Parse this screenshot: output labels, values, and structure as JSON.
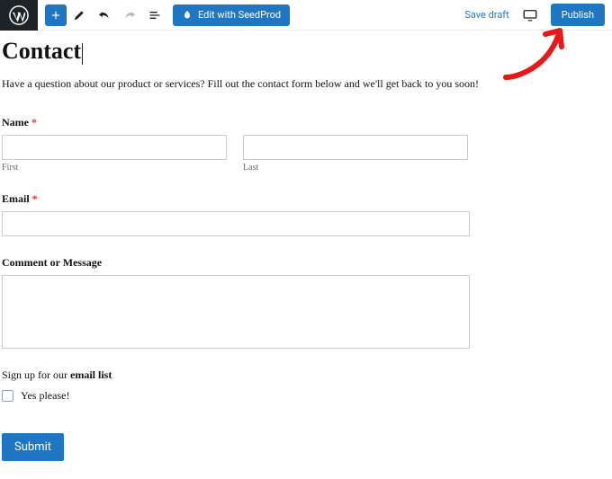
{
  "topbar": {
    "seedprod_label": "Edit with SeedProd",
    "save_draft": "Save draft",
    "publish": "Publish"
  },
  "annotation": {
    "arrow_color": "#e81818"
  },
  "page": {
    "title": "Contact",
    "intro": "Have a question about our product or services? Fill out the contact form below and we'll get back to you soon!"
  },
  "form": {
    "name": {
      "label": "Name",
      "required": "*",
      "first_sub": "First",
      "last_sub": "Last"
    },
    "email": {
      "label": "Email",
      "required": "*"
    },
    "comment": {
      "label": "Comment or Message"
    },
    "signup": {
      "label_prefix": "Sign up for our ",
      "label_bold": "email list",
      "option": "Yes please!"
    },
    "submit": "Submit"
  }
}
